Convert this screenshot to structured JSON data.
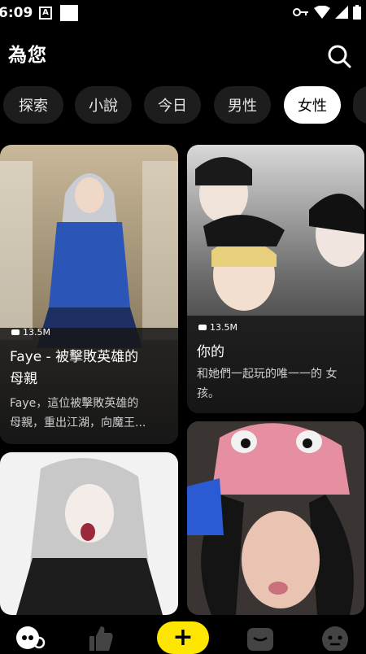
{
  "status_bar": {
    "time": "6:09",
    "notification_glyph": "A"
  },
  "header": {
    "title": "為您"
  },
  "tabs": [
    {
      "label": "探索",
      "active": false
    },
    {
      "label": "小說",
      "active": false
    },
    {
      "label": "今日",
      "active": false
    },
    {
      "label": "男性",
      "active": false
    },
    {
      "label": "女性",
      "active": true
    }
  ],
  "cards": [
    {
      "views": "13.5M",
      "title_line1": "Faye - 被擊敗英雄的",
      "title_line2": "母親",
      "description_line1": "Faye，這位被擊敗英雄的",
      "description_line2": "母親，重出江湖，向魔王..."
    },
    {
      "views": "13.5M",
      "title_line1": "你的",
      "description_line1": "和她們一起玩的唯一一的 女",
      "description_line2": "孩。"
    },
    {
      "label": "card-3"
    },
    {
      "label": "card-4"
    }
  ],
  "bottom_nav": {
    "create_label": "+",
    "icons": [
      "discover-icon",
      "thumbs-up-icon",
      "create-icon",
      "chat-icon",
      "profile-icon"
    ]
  },
  "colors": {
    "accent": "#ffe600",
    "background": "#000000",
    "tab_bg": "#1d1d1d"
  }
}
